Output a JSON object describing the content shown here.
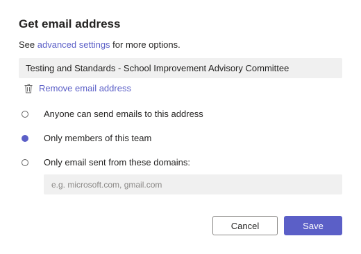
{
  "dialog": {
    "title": "Get email address",
    "subtitle_prefix": "See ",
    "subtitle_link": "advanced settings",
    "subtitle_suffix": " for more options.",
    "email_address": "Testing and Standards - School Improvement Advisory Committee",
    "remove_label": "Remove email address",
    "remove_icon": "trash-icon"
  },
  "options": [
    {
      "label": "Anyone can send emails to this address",
      "selected": false
    },
    {
      "label": "Only members of this team",
      "selected": true
    },
    {
      "label": "Only email sent from these domains:",
      "selected": false
    }
  ],
  "domains_input": {
    "value": "",
    "placeholder": "e.g. microsoft.com, gmail.com"
  },
  "buttons": {
    "cancel": "Cancel",
    "save": "Save"
  },
  "colors": {
    "accent": "#5b5fc7",
    "field_bg": "#f0f0f0"
  }
}
